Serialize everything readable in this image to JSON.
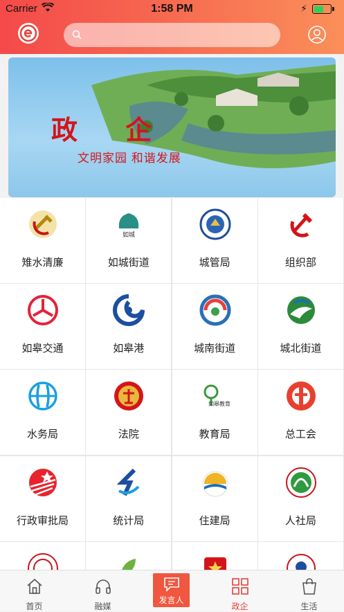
{
  "status": {
    "carrier": "Carrier",
    "time": "1:58 PM",
    "battery_level": 0.6
  },
  "search": {
    "placeholder": ""
  },
  "banner": {
    "title": "政 企",
    "slogan": "文明家园 和谐发展"
  },
  "grid": {
    "items": [
      {
        "label": "雉水清廉",
        "icon": "hammer-sickle-icon"
      },
      {
        "label": "如城街道",
        "icon": "rucheng-logo-icon"
      },
      {
        "label": "城管局",
        "icon": "urban-management-badge-icon"
      },
      {
        "label": "组织部",
        "icon": "hammer-sickle-red-icon"
      },
      {
        "label": "如皋交通",
        "icon": "transport-logo-icon"
      },
      {
        "label": "如皋港",
        "icon": "port-swirl-icon"
      },
      {
        "label": "城南街道",
        "icon": "chengnan-swirl-icon"
      },
      {
        "label": "城北街道",
        "icon": "chengbei-bird-icon"
      },
      {
        "label": "水务局",
        "icon": "water-bureau-icon"
      },
      {
        "label": "法院",
        "icon": "court-emblem-icon"
      },
      {
        "label": "教育局",
        "icon": "education-logo-icon"
      },
      {
        "label": "总工会",
        "icon": "trade-union-icon"
      },
      {
        "label": "行政审批局",
        "icon": "approval-bureau-icon"
      },
      {
        "label": "统计局",
        "icon": "statistics-icon"
      },
      {
        "label": "住建局",
        "icon": "housing-bureau-icon"
      },
      {
        "label": "人社局",
        "icon": "hr-social-icon"
      },
      {
        "label": "",
        "icon": "seal-icon"
      },
      {
        "label": "",
        "icon": "leaf-logo-icon"
      },
      {
        "label": "",
        "icon": "red-badge-icon"
      },
      {
        "label": "",
        "icon": "round-logo-icon"
      }
    ]
  },
  "tabbar": {
    "items": [
      {
        "label": "首页",
        "icon": "home-icon"
      },
      {
        "label": "融媒",
        "icon": "headphones-icon"
      },
      {
        "label": "发言人",
        "icon": "chat-bubble-icon"
      },
      {
        "label": "政企",
        "icon": "grid-icon"
      },
      {
        "label": "生活",
        "icon": "shopping-bag-icon"
      }
    ]
  },
  "colors": {
    "accent": "#e8403b",
    "header_start": "#f44a4a",
    "header_end": "#fb8f5a"
  }
}
